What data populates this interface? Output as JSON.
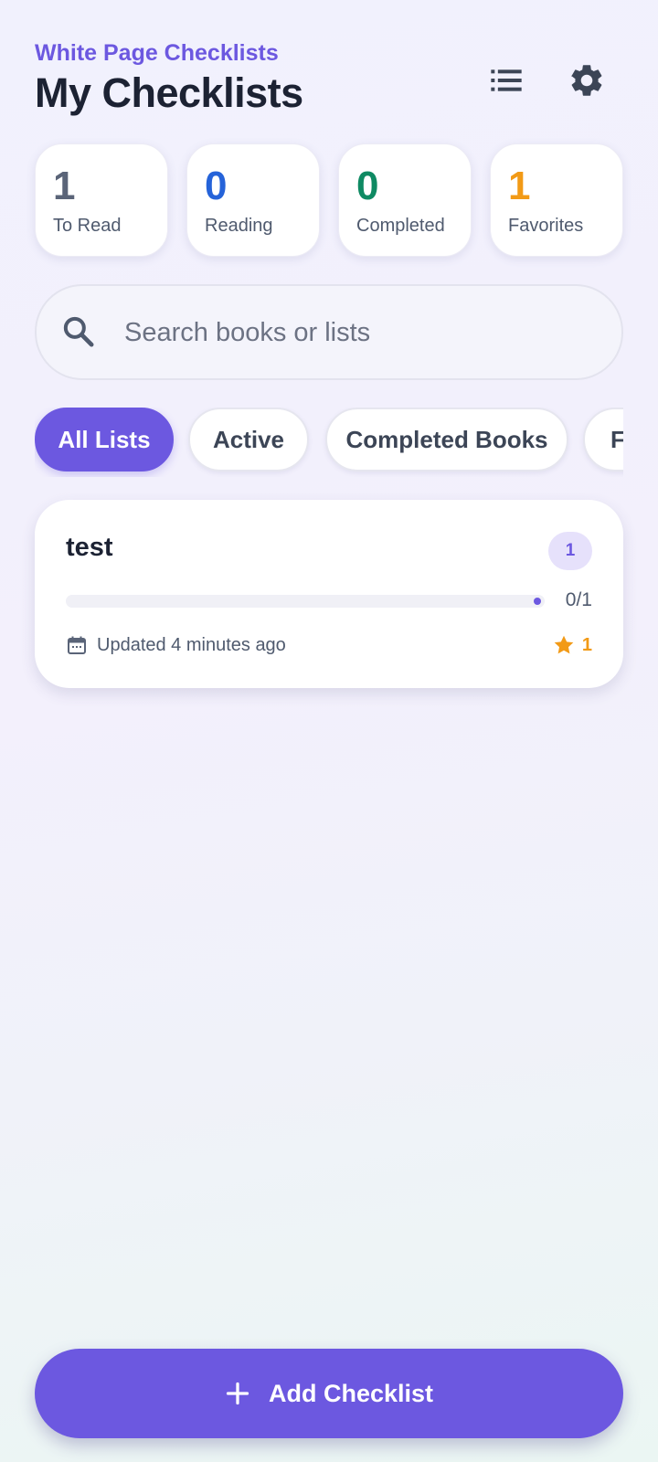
{
  "header": {
    "app_name": "White Page Checklists",
    "title": "My Checklists",
    "actions": [
      {
        "icon": "list-icon"
      },
      {
        "icon": "gear-icon"
      }
    ]
  },
  "stats": [
    {
      "value": "1",
      "label": "To Read",
      "color": "#5a6478"
    },
    {
      "value": "0",
      "label": "Reading",
      "color": "#2563d9"
    },
    {
      "value": "0",
      "label": "Completed",
      "color": "#0f8a63"
    },
    {
      "value": "1",
      "label": "Favorites",
      "color": "#f29a16"
    }
  ],
  "search": {
    "placeholder": "Search books or lists",
    "value": ""
  },
  "filters": [
    {
      "label": "All Lists",
      "active": true
    },
    {
      "label": "Active",
      "active": false
    },
    {
      "label": "Completed Books",
      "active": false
    },
    {
      "label": "F",
      "active": false
    }
  ],
  "checklists": [
    {
      "title": "test",
      "badge": "1",
      "progress_text": "0/1",
      "progress": 0,
      "updated": "Updated 4 minutes ago",
      "favorites": "1"
    }
  ],
  "fab": {
    "label": "Add Checklist"
  },
  "colors": {
    "accent": "#6c58e0",
    "favorite": "#f29a16"
  }
}
